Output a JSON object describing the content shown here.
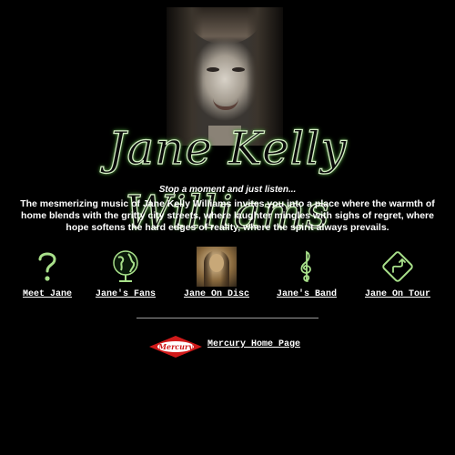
{
  "header": {
    "artist_name": "Jane Kelly Williams"
  },
  "intro": {
    "tagline": "Stop a moment and just listen...",
    "blurb": "The mesmerizing music of Jane Kelly Williams invites you into a place where the warmth of home blends with the gritty city streets, where laughter mingles with sighs of regret, where hope softens the hard edges of reality, where the spirit always prevails."
  },
  "nav": {
    "items": [
      {
        "label": "Meet Jane",
        "icon": "question-mark-icon"
      },
      {
        "label": "Jane's Fans",
        "icon": "globe-icon"
      },
      {
        "label": "Jane On Disc",
        "icon": "album-cover-icon"
      },
      {
        "label": "Jane's Band",
        "icon": "treble-clef-icon"
      },
      {
        "label": "Jane On Tour",
        "icon": "road-sign-icon"
      }
    ]
  },
  "footer": {
    "label_logo": "Mercury",
    "link_label": "Mercury Home Page"
  },
  "colors": {
    "background": "#000000",
    "logo_glow": "#7ec86a",
    "icon_green": "#a8e08a",
    "mercury_red": "#d01a1a"
  }
}
